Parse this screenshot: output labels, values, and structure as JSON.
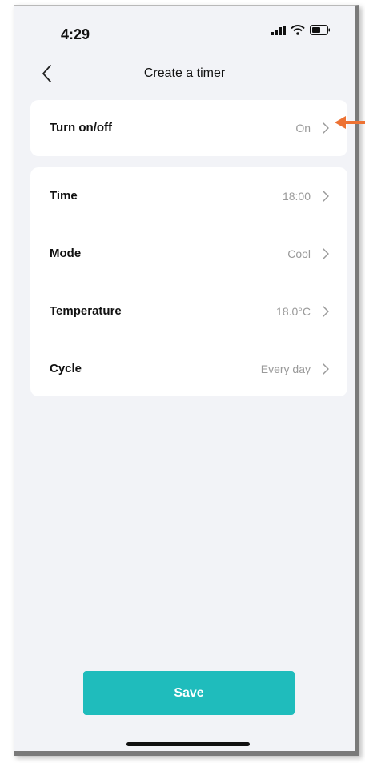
{
  "status": {
    "time": "4:29"
  },
  "nav": {
    "title": "Create a timer"
  },
  "power": {
    "label": "Turn on/off",
    "value": "On"
  },
  "settings": [
    {
      "label": "Time",
      "value": "18:00"
    },
    {
      "label": "Mode",
      "value": "Cool"
    },
    {
      "label": "Temperature",
      "value": "18.0°C"
    },
    {
      "label": "Cycle",
      "value": "Every day"
    }
  ],
  "save_label": "Save",
  "icons": [
    "signal-icon",
    "wifi-icon",
    "battery-icon",
    "back-chevron-icon",
    "chevron-right-icon",
    "annotation-arrow-icon"
  ],
  "colors": {
    "accent": "#1fbcbc",
    "annotation": "#ed7233",
    "background": "#f2f3f7"
  }
}
